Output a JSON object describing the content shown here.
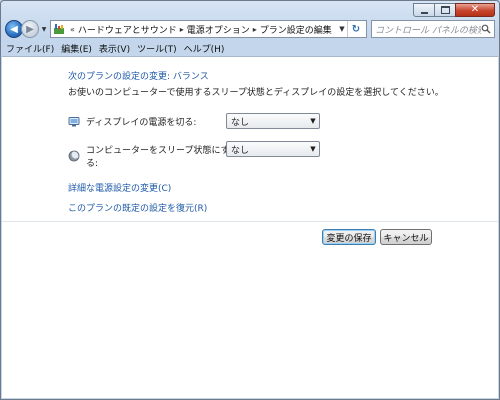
{
  "nav": {
    "back_glyph": "◀",
    "forward_glyph": "▶",
    "breadcrumb_prefix": "«",
    "breadcrumbs": [
      "ハードウェアとサウンド",
      "電源オプション",
      "プラン設定の編集"
    ],
    "search_placeholder": "コントロール パネルの検索"
  },
  "menu": [
    "ファイル(F)",
    "編集(E)",
    "表示(V)",
    "ツール(T)",
    "ヘルプ(H)"
  ],
  "content": {
    "heading": "次のプランの設定の変更: バランス",
    "description": "お使いのコンピューターで使用するスリープ状態とディスプレイの設定を選択してください。",
    "display_label": "ディスプレイの電源を切る:",
    "display_value": "なし",
    "sleep_label": "コンピューターをスリープ状態にする:",
    "sleep_value": "なし",
    "advanced_link": "詳細な電源設定の変更(C)",
    "restore_link": "このプランの既定の設定を復元(R)"
  },
  "buttons": {
    "save": "変更の保存",
    "cancel": "キャンセル"
  },
  "colors": {
    "link": "#1e5aa8",
    "accent": "#3c7fb1"
  }
}
